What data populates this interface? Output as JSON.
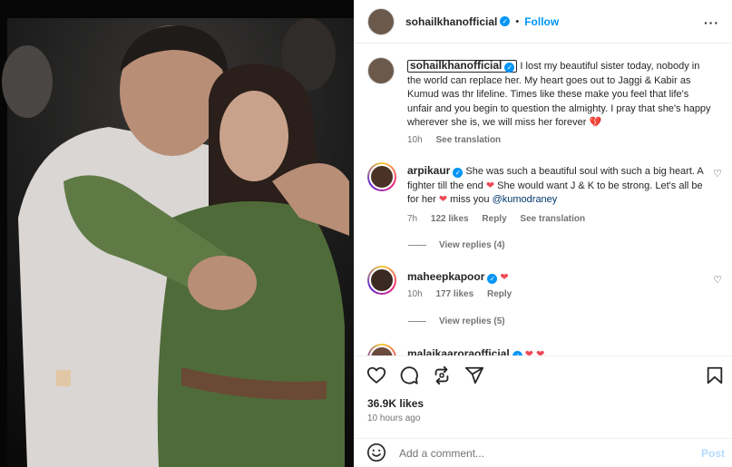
{
  "header": {
    "username": "sohailkhanofficial",
    "dot": "•",
    "follow_label": "Follow",
    "more_icon": "more-options-icon"
  },
  "caption": {
    "username": "sohailkhanofficial",
    "text": " I lost my beautiful sister today, nobody in the world can replace her. My heart goes out to Jaggi & Kabir as Kumud was thr lifeline. Times like these make you feel that life's unfair and you begin to question the almighty. I pray that she's happy wherever she is, we will miss her forever ",
    "emoji": "💔",
    "time": "10h",
    "see_translation": "See translation"
  },
  "comments": [
    {
      "username": "arpikaur",
      "text_before": " She was such a beautiful soul with such a big heart. A fighter till the end ",
      "heart1": "❤",
      "text_mid": " She would want J & K to be strong. Let's all be for her ",
      "heart2": "❤",
      "text_after": " miss you ",
      "mention": "@kumodraney",
      "time": "7h",
      "likes": "122 likes",
      "reply": "Reply",
      "see_translation": "See translation",
      "view_replies": "View replies (4)"
    },
    {
      "username": "maheepkapoor",
      "heart": "❤",
      "time": "10h",
      "likes": "177 likes",
      "reply": "Reply",
      "view_replies": "View replies (5)"
    },
    {
      "username": "malaikaaroraofficial",
      "hearts": "❤ ❤"
    }
  ],
  "actions": {
    "like_icon": "heart-outline-icon",
    "comment_icon": "comment-icon",
    "share_icon": "repost-icon",
    "send_icon": "send-icon",
    "save_icon": "bookmark-icon"
  },
  "stats": {
    "likes": "36.9K likes",
    "ago": "10 hours ago"
  },
  "composer": {
    "emoji_icon": "emoji-icon",
    "placeholder": "Add a comment...",
    "post_label": "Post"
  },
  "colors": {
    "accent": "#0095f6",
    "heart": "#ed4956",
    "muted": "#737373"
  }
}
